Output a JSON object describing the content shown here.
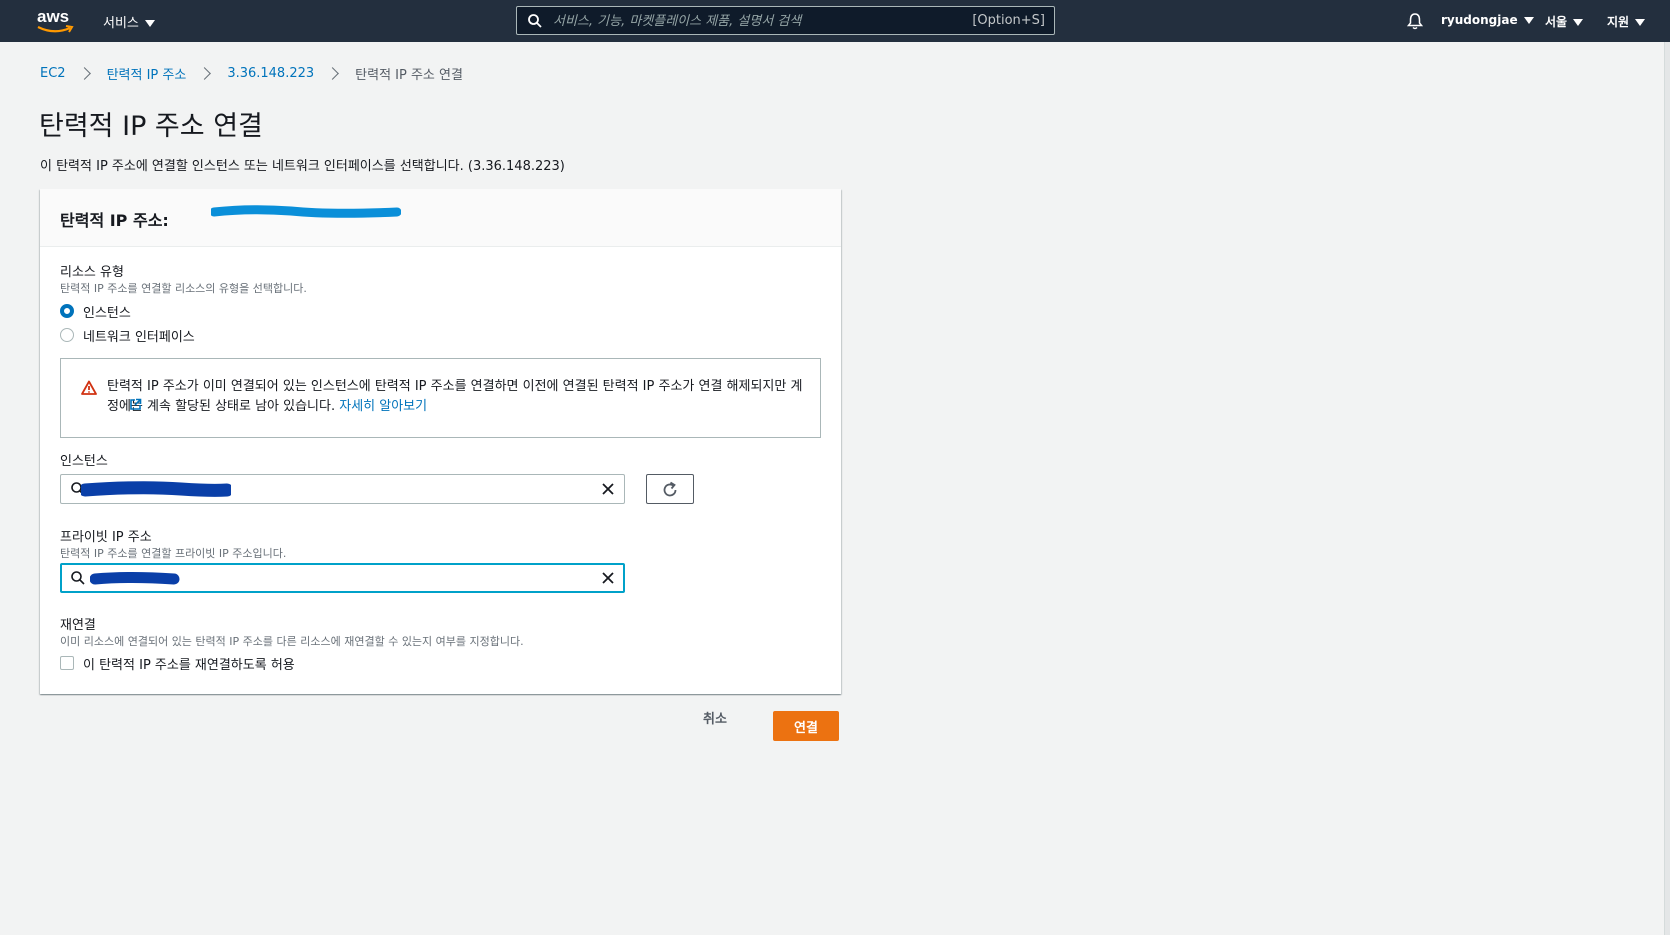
{
  "topnav": {
    "logo_text": "aws",
    "services_label": "서비스",
    "search_placeholder": "서비스, 기능, 마켓플레이스 제품, 설명서 검색",
    "search_shortcut": "[Option+S]",
    "username": "ryudongjae",
    "region": "서울",
    "support": "지원"
  },
  "breadcrumb": {
    "items": [
      "EC2",
      "탄력적 IP 주소",
      "3.36.148.223"
    ],
    "current": "탄력적 IP 주소 연결"
  },
  "page": {
    "title": "탄력적 IP 주소 연결",
    "description": "이 탄력적 IP 주소에 연결할 인스턴스 또는 네트워크 인터페이스를 선택합니다. (3.36.148.223)"
  },
  "panel": {
    "title": "탄력적 IP 주소: ",
    "resource_type": {
      "label": "리소스 유형",
      "description": "탄력적 IP 주소를 연결할 리소스의 유형을 선택합니다.",
      "options": [
        "인스턴스",
        "네트워크 인터페이스"
      ],
      "selected": "인스턴스"
    },
    "alert": {
      "text": "탄력적 IP 주소가 이미 연결되어 있는 인스턴스에 탄력적 IP 주소를 연결하면 이전에 연결된 탄력적 IP 주소가 연결 해제되지만 계정에는 계속 할당된 상태로 남아 있습니다. ",
      "link": "자세히 알아보기"
    },
    "instance": {
      "label": "인스턴스"
    },
    "private_ip": {
      "label": "프라이빗 IP 주소",
      "description": "탄력적 IP 주소를 연결할 프라이빗 IP 주소입니다."
    },
    "reassociate": {
      "label": "재연결",
      "description": "이미 리소스에 연결되어 있는 탄력적 IP 주소를 다른 리소스에 재연결할 수 있는지 여부를 지정합니다.",
      "checkbox_label": "이 탄력적 IP 주소를 재연결하도록 허용",
      "checked": false
    }
  },
  "actions": {
    "cancel": "취소",
    "connect": "연결"
  },
  "colors": {
    "nav_bg": "#232f3e",
    "link": "#0073bb",
    "primary_button": "#ec7211",
    "focus": "#00a1c9",
    "warning": "#d13212",
    "redaction": "#0a3fa8"
  }
}
